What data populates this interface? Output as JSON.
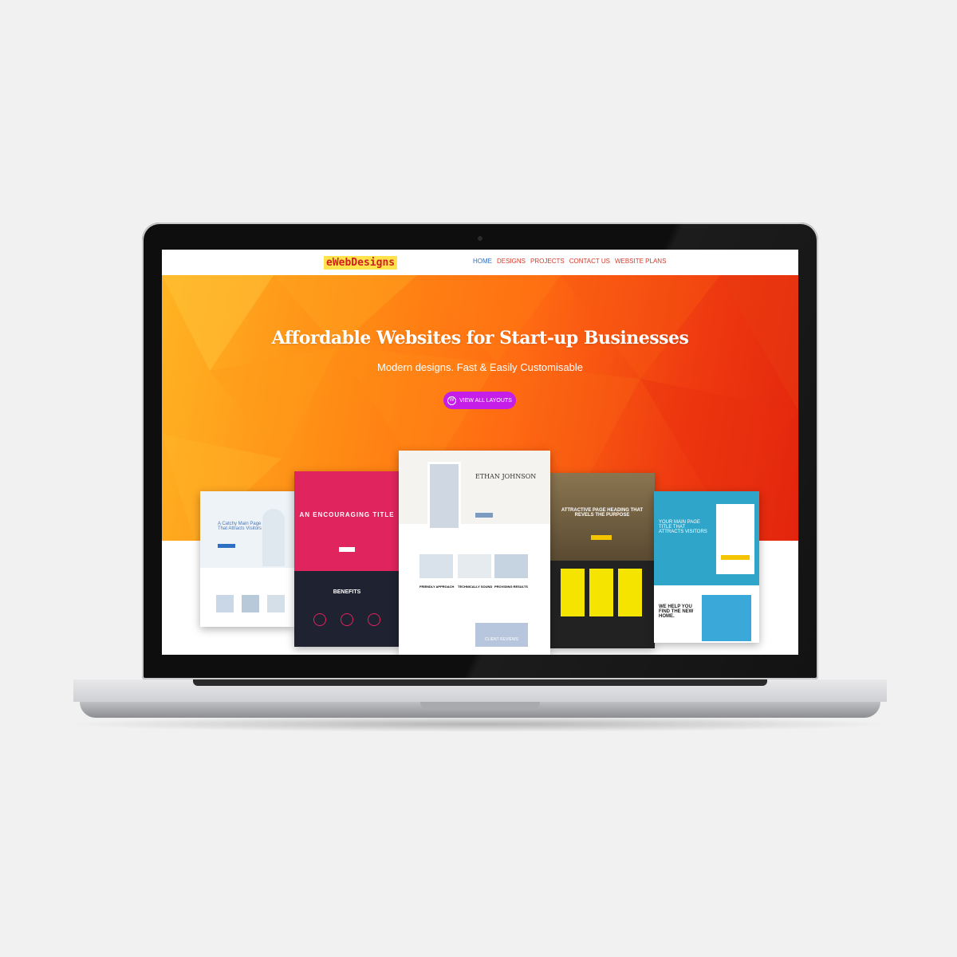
{
  "site": {
    "logo": "eWebDesigns",
    "menu": [
      "HOME",
      "DESIGNS",
      "PROJECTS",
      "CONTACT US",
      "WEBSITE PLANS"
    ],
    "hero_title": "Affordable Websites for Start-up Businesses",
    "hero_subtitle": "Modern designs. Fast & Easily Customisable",
    "cta_label": "VIEW ALL LAYOUTS"
  },
  "previews": {
    "card1_title": "A Catchy Main Page Title That Attracts Visitors",
    "card2_title": "AN ENCOURAGING TITLE",
    "card2_section": "BENEFITS",
    "card3_name": "ETHAN JOHNSON",
    "card3_features": [
      "FRIENDLY APPROACH",
      "TECHNICALLY SOUND",
      "PROVIDING RESULTS"
    ],
    "card3_reviews": "CLIENT REVIEWS",
    "card4_title": "ATTRACTIVE PAGE HEADING THAT REVELS THE PURPOSE",
    "card5_title": "YOUR MAIN PAGE TITLE THAT ATTRACTS VISITORS",
    "card5_sub": "WE HELP YOU FIND THE NEW HOME."
  },
  "colors": {
    "accent": "#c41ee8",
    "logo": "#d11f1f",
    "nav_link": "#d63a2b",
    "nav_active": "#2b6fc9"
  }
}
